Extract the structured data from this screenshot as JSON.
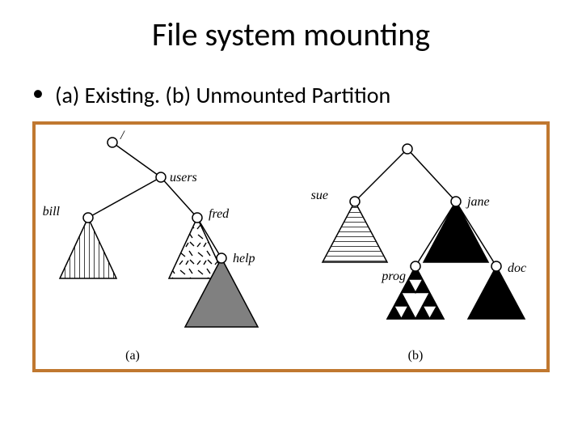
{
  "title": "File system mounting",
  "bullet": "(a) Existing.  (b) Unmounted Partition",
  "diagram": {
    "tree_a": {
      "root": "/",
      "users": "users",
      "bill": "bill",
      "fred": "fred",
      "help": "help",
      "caption": "(a)"
    },
    "tree_b": {
      "sue": "sue",
      "jane": "jane",
      "prog": "prog",
      "doc": "doc",
      "caption": "(b)"
    }
  }
}
